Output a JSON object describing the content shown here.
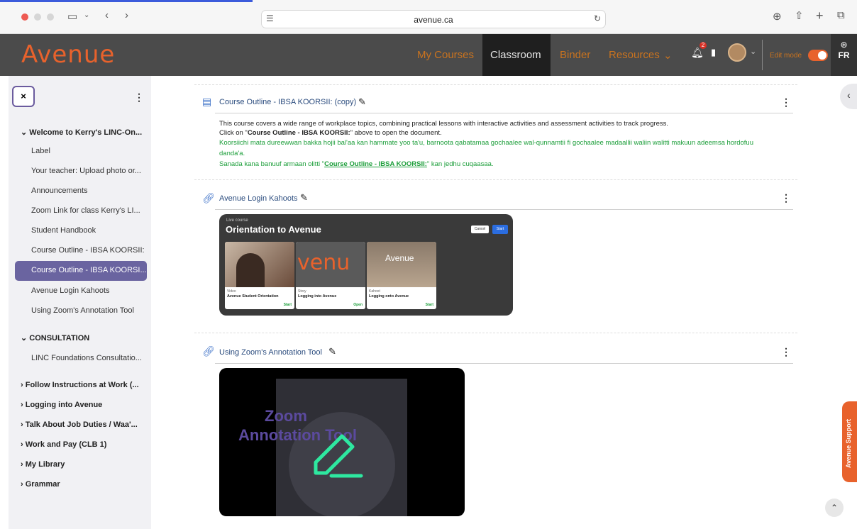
{
  "browser": {
    "url": "avenue.ca"
  },
  "navbar": {
    "logo": "Avenue",
    "items": [
      "My Courses",
      "Classroom",
      "Binder",
      "Resources"
    ],
    "notification_count": "2",
    "edit_mode_label": "Edit mode",
    "language": "FR"
  },
  "sidebar": {
    "close_label": "×",
    "sections": [
      {
        "title": "Welcome to Kerry's LINC-On...",
        "expanded": true,
        "items": [
          "Label",
          "Your teacher: Upload photo or...",
          "Announcements",
          "Zoom Link for class Kerry's LI...",
          "Student Handbook",
          "Course Outline - IBSA KOORSII:",
          "Course Outline - IBSA KOORSI...",
          "Avenue Login Kahoots",
          "Using Zoom's Annotation Tool"
        ],
        "active_index": 6
      },
      {
        "title": "CONSULTATION",
        "expanded": true,
        "items": [
          "LINC Foundations Consultatio..."
        ]
      },
      {
        "title": "Follow Instructions at Work (...",
        "expanded": false
      },
      {
        "title": "Logging into Avenue",
        "expanded": false
      },
      {
        "title": "Talk About Job Duties / Waa'...",
        "expanded": false
      },
      {
        "title": "Work and Pay (CLB 1)",
        "expanded": false
      },
      {
        "title": "My Library",
        "expanded": false
      },
      {
        "title": "Grammar",
        "expanded": false
      }
    ]
  },
  "main": {
    "activities": [
      {
        "icon": "pdf-icon",
        "title": "Course Outline - IBSA KOORSII: (copy)",
        "desc_line1": "This course covers a wide range of workplace topics, combining practical lessons with interactive activities and assessment activities to track progress.",
        "desc_line2_pre": "Click on \"",
        "desc_line2_bold": "Course Outline - IBSA KOORSII:",
        "desc_line2_post": "\" above to open the document.",
        "desc_green1": "Koorsiichi mata dureewwan bakka hojii bal'aa kan hammate yoo ta'u, barnoota qabatamaa gochaalee wal-qunnamtii fi gochaalee madaallii waliin walitti makuun adeemsa hordofuu",
        "desc_green2": "danda'a.",
        "desc_green3_pre": "Sanada kana banuuf armaan olitti \"",
        "desc_green3_link": "Course Outline - IBSA KOORSII:",
        "desc_green3_post": "\" kan jedhu cuqaasaa."
      },
      {
        "icon": "link-icon",
        "title": "Avenue Login Kahoots",
        "card": {
          "tag": "Live course",
          "title": "Orientation to Avenue",
          "cancel": "Cancel",
          "start": "Start",
          "tiles": [
            {
              "type": "Video",
              "name": "Avenue Student Orientation",
              "action": "Start"
            },
            {
              "type": "Story",
              "name": "Logging into Avenue",
              "action": "Open"
            },
            {
              "type": "Kahoot",
              "name": "Logging onto Avenue",
              "action": "Start"
            }
          ],
          "tile2_logo": "venu",
          "tile3_logo": "Avenue"
        }
      },
      {
        "icon": "link-icon",
        "title": "Using Zoom's Annotation Tool",
        "video_line1": "Zoom",
        "video_line2": "Annotation Tool"
      }
    ]
  },
  "support_label": "Avenue Support",
  "colors": {
    "brand_orange": "#e8622c",
    "nav_bg": "#4b4b4b",
    "active_sidebar": "#6a64a0",
    "green_text": "#1c9e3a",
    "link_blue": "#2b4c7e"
  }
}
